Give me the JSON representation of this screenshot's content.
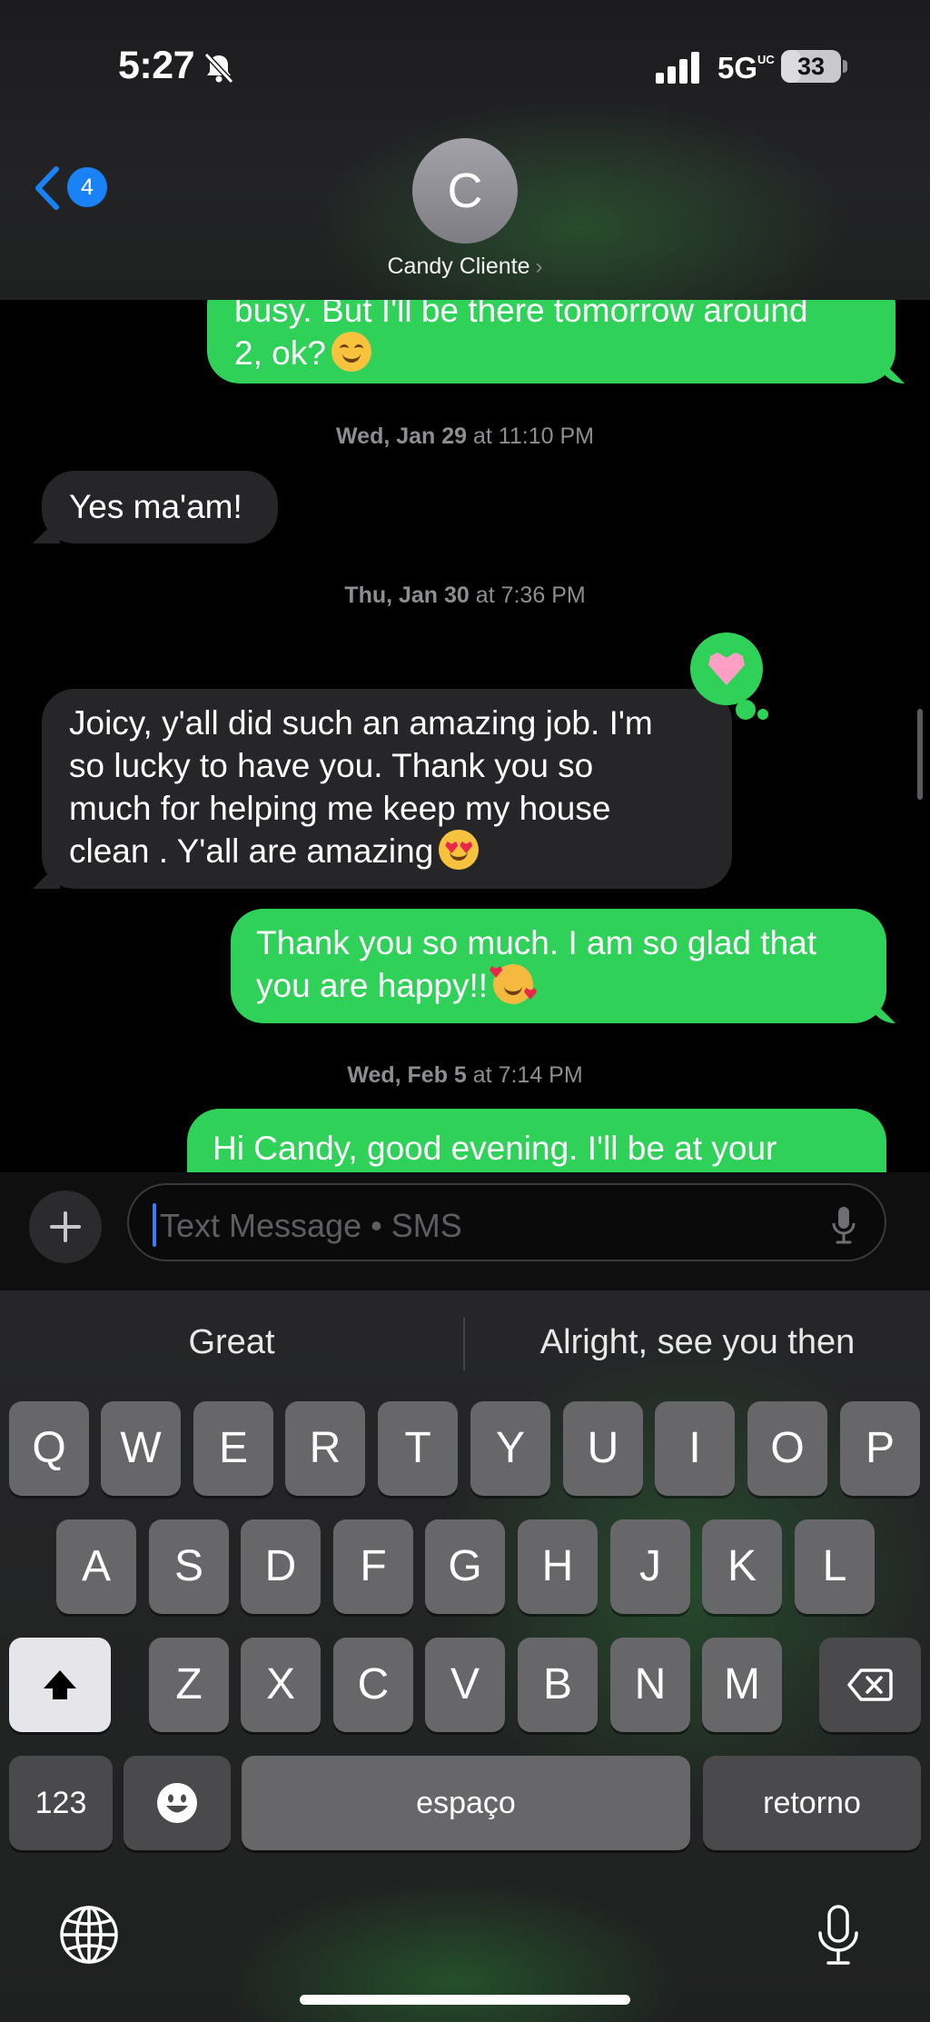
{
  "status_bar": {
    "time": "5:27",
    "network": "5G",
    "network_suffix": "UC",
    "battery": "33",
    "battery_level_percent": 33
  },
  "header": {
    "back_badge": "4",
    "avatar_initial": "C",
    "contact_name": "Candy Cliente",
    "contact_chevron": "›"
  },
  "messages": {
    "m1_line1": "busy. But I'll be there tomorrow around",
    "m1_line2": "2, ok?",
    "ts1_day": "Wed, Jan 29",
    "ts1_rest": " at 11:10 PM",
    "m2": "Yes ma'am!",
    "ts2_day": "Thu, Jan 30",
    "ts2_rest": " at 7:36 PM",
    "m3_line1": "Joicy, y'all did such an amazing job. I'm",
    "m3_line2": "so lucky to have you. Thank you so",
    "m3_line3": "much for helping me keep my house",
    "m3_line4": "clean . Y'all are amazing",
    "m4_line1": "Thank you so much. I am so glad that",
    "m4_line2": "you are happy!!",
    "ts3_day": "Wed, Feb 5",
    "ts3_rest": " at 7:14 PM",
    "m5_line1": "Hi Candy, good evening. I'll be at your"
  },
  "compose": {
    "placeholder": "Text Message • SMS"
  },
  "keyboard": {
    "suggestions": [
      "Great",
      "Alright, see you then"
    ],
    "row1": [
      "Q",
      "W",
      "E",
      "R",
      "T",
      "Y",
      "U",
      "I",
      "O",
      "P"
    ],
    "row2": [
      "A",
      "S",
      "D",
      "F",
      "G",
      "H",
      "J",
      "K",
      "L"
    ],
    "row3": [
      "Z",
      "X",
      "C",
      "V",
      "B",
      "N",
      "M"
    ],
    "numbers_key": "123",
    "space_key": "espaço",
    "return_key": "retorno"
  },
  "colors": {
    "outgoing_bubble": "#30d158",
    "incoming_bubble": "#262629",
    "accent": "#1a82f7"
  },
  "icons": [
    "bell-slash-icon",
    "signal-icon",
    "chevron-left-icon",
    "plus-icon",
    "microphone-icon",
    "shift-icon",
    "delete-icon",
    "emoji-icon",
    "globe-icon",
    "heart-icon"
  ]
}
